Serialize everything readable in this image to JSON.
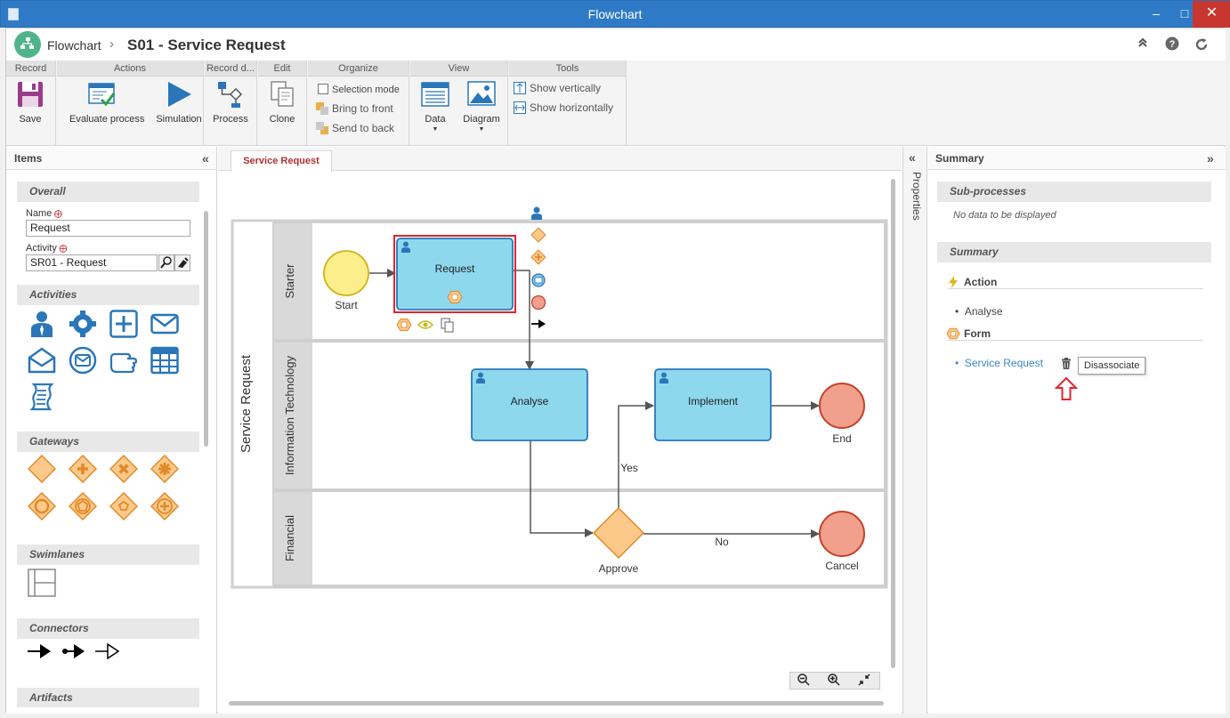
{
  "window": {
    "title": "Flowchart"
  },
  "header": {
    "breadcrumb_app": "Flowchart",
    "page_title": "S01 - Service Request"
  },
  "ribbon": {
    "groups": {
      "record": "Record",
      "actions": "Actions",
      "record_d": "Record d...",
      "edit": "Edit",
      "organize": "Organize",
      "view": "View",
      "tools": "Tools"
    },
    "save": "Save",
    "evaluate_process": "Evaluate process",
    "simulation": "Simulation",
    "process": "Process",
    "clone": "Clone",
    "selection_mode": "Selection mode",
    "bring_to_front": "Bring to front",
    "send_to_back": "Send to back",
    "data": "Data",
    "diagram": "Diagram",
    "show_vertically": "Show vertically",
    "show_horizontally": "Show horizontally"
  },
  "items_panel": {
    "title": "Items",
    "overall": "Overall",
    "name_label": "Name",
    "name_value": "Request",
    "activity_label": "Activity",
    "activity_value": "SR01 - Request",
    "activities": "Activities",
    "gateways": "Gateways",
    "swimlanes": "Swimlanes",
    "connectors": "Connectors",
    "artifacts": "Artifacts"
  },
  "canvas": {
    "tab": "Service Request",
    "pool": "Service Request",
    "lanes": [
      "Starter",
      "Information Technology",
      "Financial"
    ],
    "nodes": {
      "start": "Start",
      "request": "Request",
      "analyse": "Analyse",
      "implement": "Implement",
      "end": "End",
      "approve": "Approve",
      "cancel": "Cancel"
    },
    "edges": {
      "yes": "Yes",
      "no": "No"
    }
  },
  "properties": {
    "label": "Properties"
  },
  "summary_panel": {
    "title": "Summary",
    "subprocesses": "Sub-processes",
    "no_data": "No data to be displayed",
    "summary": "Summary",
    "action": "Action",
    "action_item": "Analyse",
    "form": "Form",
    "form_item": "Service Request",
    "tooltip": "Disassociate"
  },
  "colors": {
    "titlebar": "#2f7ac6",
    "task_fill": "#8ed8ee",
    "task_stroke": "#2a76b8",
    "selection": "#e0262c",
    "start_fill": "#fcee8a",
    "end_fill": "#f1a08d",
    "gateway_fill": "#fcc98a",
    "link": "#3a86c8"
  }
}
